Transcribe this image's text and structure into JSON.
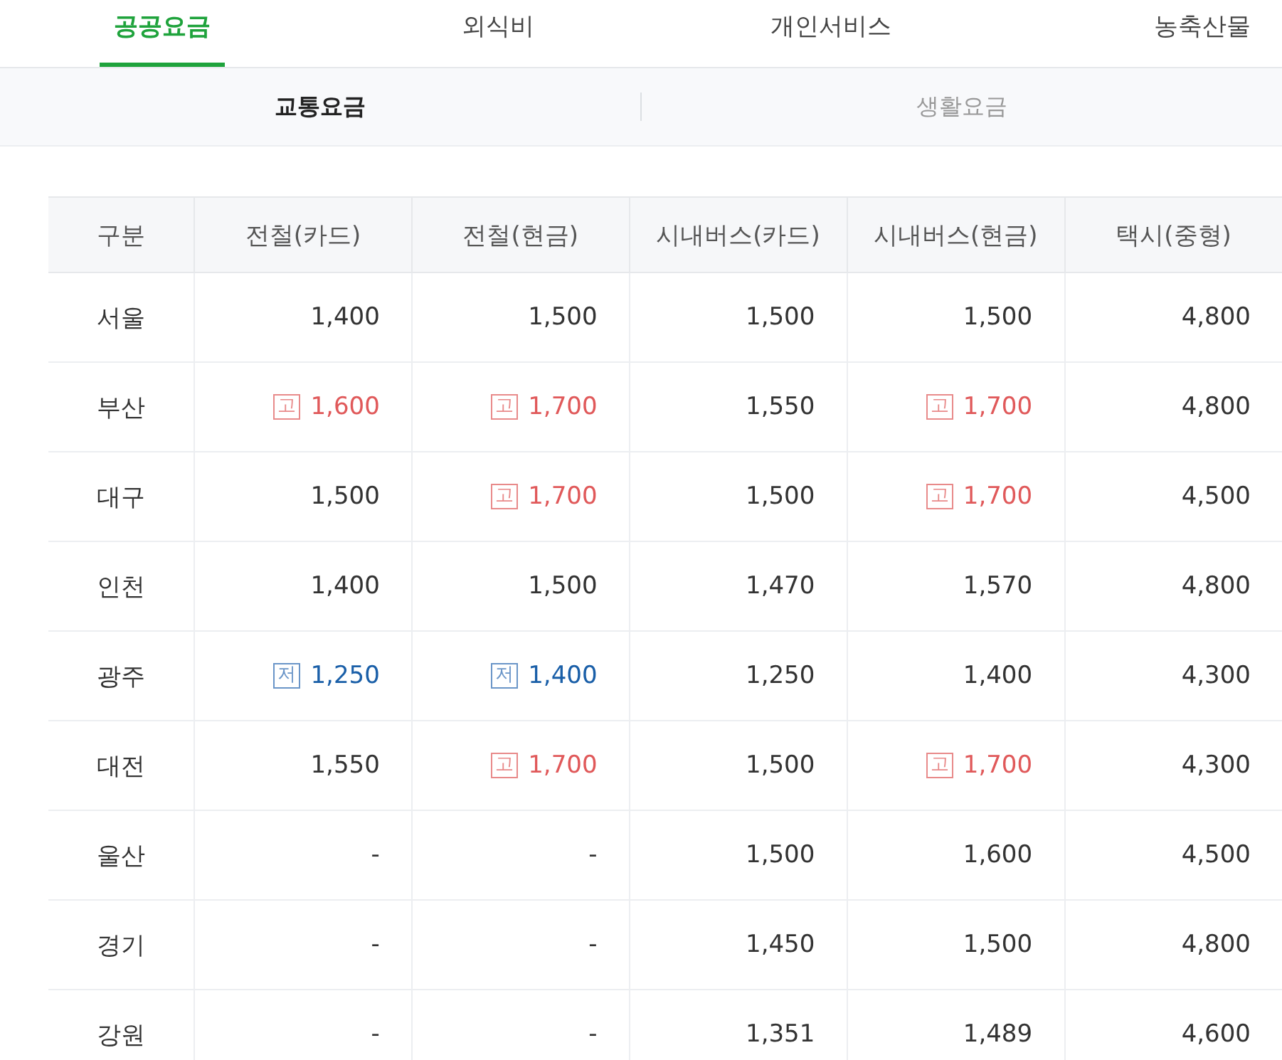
{
  "tabs": [
    {
      "label": "공공요금",
      "selected": true
    },
    {
      "label": "외식비",
      "selected": false
    },
    {
      "label": "개인서비스",
      "selected": false
    },
    {
      "label": "농축산물",
      "selected": false
    }
  ],
  "subtabs": [
    {
      "label": "교통요금",
      "selected": true
    },
    {
      "label": "생활요금",
      "selected": false
    }
  ],
  "table": {
    "columns": [
      "구분",
      "전철(카드)",
      "전철(현금)",
      "시내버스(카드)",
      "시내버스(현금)",
      "택시(중형)"
    ],
    "rows": [
      {
        "cells": [
          {
            "value": "서울",
            "kind": "region"
          },
          {
            "value": "1,400",
            "kind": "normal"
          },
          {
            "value": "1,500",
            "kind": "normal"
          },
          {
            "value": "1,500",
            "kind": "normal"
          },
          {
            "value": "1,500",
            "kind": "normal"
          },
          {
            "value": "4,800",
            "kind": "normal"
          }
        ]
      },
      {
        "cells": [
          {
            "value": "부산",
            "kind": "region"
          },
          {
            "value": "1,600",
            "kind": "high",
            "badge": "고"
          },
          {
            "value": "1,700",
            "kind": "high",
            "badge": "고"
          },
          {
            "value": "1,550",
            "kind": "normal"
          },
          {
            "value": "1,700",
            "kind": "high",
            "badge": "고"
          },
          {
            "value": "4,800",
            "kind": "normal"
          }
        ]
      },
      {
        "cells": [
          {
            "value": "대구",
            "kind": "region"
          },
          {
            "value": "1,500",
            "kind": "normal"
          },
          {
            "value": "1,700",
            "kind": "high",
            "badge": "고"
          },
          {
            "value": "1,500",
            "kind": "normal"
          },
          {
            "value": "1,700",
            "kind": "high",
            "badge": "고"
          },
          {
            "value": "4,500",
            "kind": "normal"
          }
        ]
      },
      {
        "cells": [
          {
            "value": "인천",
            "kind": "region"
          },
          {
            "value": "1,400",
            "kind": "normal"
          },
          {
            "value": "1,500",
            "kind": "normal"
          },
          {
            "value": "1,470",
            "kind": "normal"
          },
          {
            "value": "1,570",
            "kind": "normal"
          },
          {
            "value": "4,800",
            "kind": "normal"
          }
        ]
      },
      {
        "cells": [
          {
            "value": "광주",
            "kind": "region"
          },
          {
            "value": "1,250",
            "kind": "low",
            "badge": "저"
          },
          {
            "value": "1,400",
            "kind": "low",
            "badge": "저"
          },
          {
            "value": "1,250",
            "kind": "normal"
          },
          {
            "value": "1,400",
            "kind": "normal"
          },
          {
            "value": "4,300",
            "kind": "normal"
          }
        ]
      },
      {
        "cells": [
          {
            "value": "대전",
            "kind": "region"
          },
          {
            "value": "1,550",
            "kind": "normal"
          },
          {
            "value": "1,700",
            "kind": "high",
            "badge": "고"
          },
          {
            "value": "1,500",
            "kind": "normal"
          },
          {
            "value": "1,700",
            "kind": "high",
            "badge": "고"
          },
          {
            "value": "4,300",
            "kind": "normal"
          }
        ]
      },
      {
        "cells": [
          {
            "value": "울산",
            "kind": "region"
          },
          {
            "value": "-",
            "kind": "normal"
          },
          {
            "value": "-",
            "kind": "normal"
          },
          {
            "value": "1,500",
            "kind": "normal"
          },
          {
            "value": "1,600",
            "kind": "normal"
          },
          {
            "value": "4,500",
            "kind": "normal"
          }
        ]
      },
      {
        "cells": [
          {
            "value": "경기",
            "kind": "region"
          },
          {
            "value": "-",
            "kind": "normal"
          },
          {
            "value": "-",
            "kind": "normal"
          },
          {
            "value": "1,450",
            "kind": "normal"
          },
          {
            "value": "1,500",
            "kind": "normal"
          },
          {
            "value": "4,800",
            "kind": "normal"
          }
        ]
      },
      {
        "cells": [
          {
            "value": "강원",
            "kind": "region"
          },
          {
            "value": "-",
            "kind": "normal"
          },
          {
            "value": "-",
            "kind": "normal"
          },
          {
            "value": "1,351",
            "kind": "normal"
          },
          {
            "value": "1,489",
            "kind": "normal"
          },
          {
            "value": "4,600",
            "kind": "normal"
          }
        ]
      }
    ]
  }
}
